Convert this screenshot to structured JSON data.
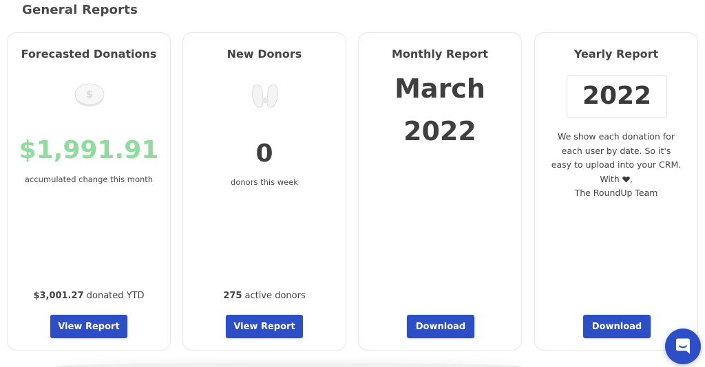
{
  "section": {
    "title": "General Reports"
  },
  "cards": {
    "forecasted": {
      "title": "Forecasted Donations",
      "icon": "coin-icon",
      "amount": "$1,991.91",
      "amount_caption": "accumulated change this month",
      "footer_value": "$3,001.27",
      "footer_text": " donated YTD",
      "button": "View Report"
    },
    "new_donors": {
      "title": "New Donors",
      "icon": "giving-hands-icon",
      "count": "0",
      "count_caption": "donors this week",
      "footer_value": "275",
      "footer_text": " active donors",
      "button": "View Report"
    },
    "monthly": {
      "title": "Monthly Report",
      "month": "March",
      "year": "2022",
      "button": "Download"
    },
    "yearly": {
      "title": "Yearly Report",
      "year": "2022",
      "message_line1": "We show each donation for",
      "message_line2": "each user by date. So it's",
      "message_line3": "easy to upload into your CRM.",
      "message_line4_prefix": "With ",
      "message_line4_suffix": ",",
      "message_line5": "The RoundUp Team",
      "button": "Download"
    }
  },
  "colors": {
    "accent": "#2c4fc7",
    "positive": "#8fdc9c"
  },
  "chat": {
    "icon": "chat-icon"
  }
}
